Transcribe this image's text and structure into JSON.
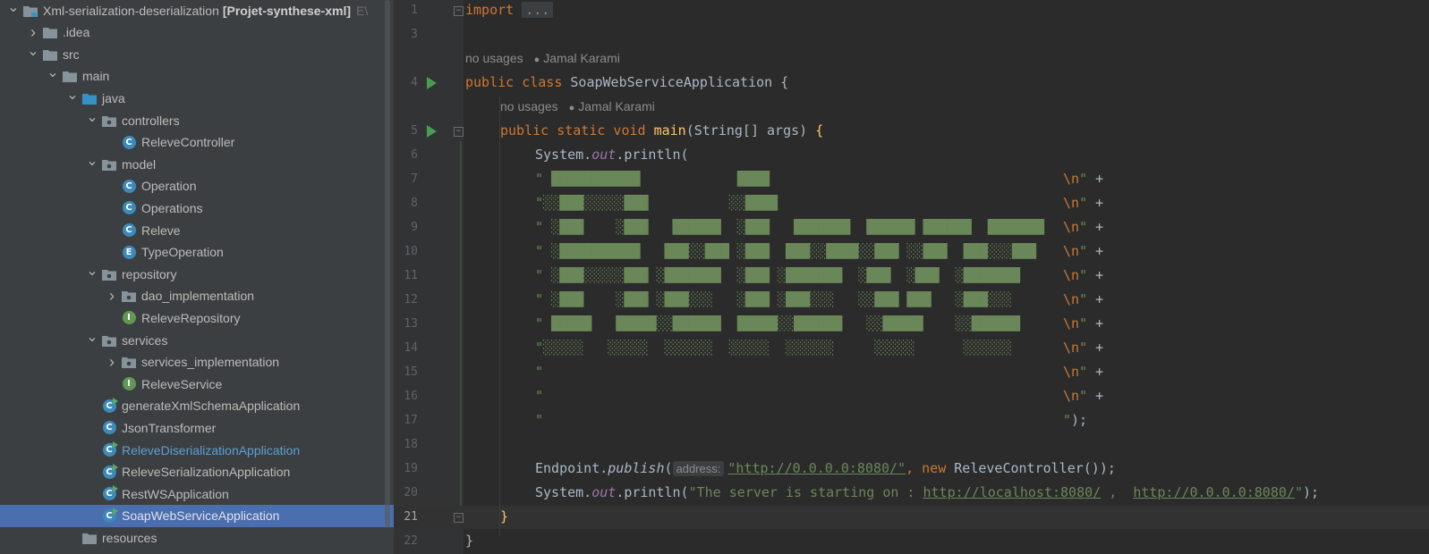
{
  "project_tree": {
    "rows": [
      {
        "label": "Xml-serialization-deserialization",
        "bold_suffix": "[Projet-synthese-xml]",
        "truncated": "E\\",
        "indent": 0,
        "chevron": "down",
        "icon": "module-folder-icon"
      },
      {
        "label": ".idea",
        "indent": 1,
        "chevron": "right",
        "icon": "folder-icon"
      },
      {
        "label": "src",
        "indent": 1,
        "chevron": "down",
        "icon": "folder-icon"
      },
      {
        "label": "main",
        "indent": 2,
        "chevron": "down",
        "icon": "folder-icon"
      },
      {
        "label": "java",
        "indent": 3,
        "chevron": "down",
        "icon": "source-folder-icon"
      },
      {
        "label": "controllers",
        "indent": 4,
        "chevron": "down",
        "icon": "package-icon"
      },
      {
        "label": "ReleveController",
        "indent": 5,
        "chevron": "",
        "icon": "class-icon"
      },
      {
        "label": "model",
        "indent": 4,
        "chevron": "down",
        "icon": "package-icon"
      },
      {
        "label": "Operation",
        "indent": 5,
        "chevron": "",
        "icon": "class-icon"
      },
      {
        "label": "Operations",
        "indent": 5,
        "chevron": "",
        "icon": "class-icon"
      },
      {
        "label": "Releve",
        "indent": 5,
        "chevron": "",
        "icon": "class-icon"
      },
      {
        "label": "TypeOperation",
        "indent": 5,
        "chevron": "",
        "icon": "enum-icon"
      },
      {
        "label": "repository",
        "indent": 4,
        "chevron": "down",
        "icon": "package-icon"
      },
      {
        "label": "dao_implementation",
        "indent": 5,
        "chevron": "right",
        "icon": "package-icon"
      },
      {
        "label": "ReleveRepository",
        "indent": 5,
        "chevron": "",
        "icon": "interface-icon"
      },
      {
        "label": "services",
        "indent": 4,
        "chevron": "down",
        "icon": "package-icon"
      },
      {
        "label": "services_implementation",
        "indent": 5,
        "chevron": "right",
        "icon": "package-icon"
      },
      {
        "label": "ReleveService",
        "indent": 5,
        "chevron": "",
        "icon": "interface-icon"
      },
      {
        "label": "generateXmlSchemaApplication",
        "indent": 4,
        "chevron": "",
        "icon": "runnable-class-icon"
      },
      {
        "label": "JsonTransformer",
        "indent": 4,
        "chevron": "",
        "icon": "class-icon"
      },
      {
        "label": "ReleveDiserializationApplication",
        "indent": 4,
        "chevron": "",
        "icon": "runnable-class-icon",
        "muted_blue": true
      },
      {
        "label": "ReleveSerializationApplication",
        "indent": 4,
        "chevron": "",
        "icon": "runnable-class-icon"
      },
      {
        "label": "RestWSApplication",
        "indent": 4,
        "chevron": "",
        "icon": "runnable-class-icon"
      },
      {
        "label": "SoapWebServiceApplication",
        "indent": 4,
        "chevron": "",
        "icon": "runnable-class-icon",
        "selected": true
      },
      {
        "label": "resources",
        "indent": 3,
        "chevron": "",
        "icon": "resources-folder-icon"
      }
    ]
  },
  "editor": {
    "file_class": "SoapWebServiceApplication",
    "current_line": "21",
    "line_numbers": [
      "1",
      "3",
      "4",
      "5",
      "6",
      "7",
      "8",
      "9",
      "10",
      "11",
      "12",
      "13",
      "14",
      "15",
      "16",
      "17",
      "18",
      "19",
      "20",
      "21",
      "22"
    ],
    "hints": {
      "usages": "no usages",
      "author": "Jamal Karami"
    },
    "code": {
      "l1_kw": "import",
      "l1_fold": "...",
      "l4_kw": "public class",
      "l4_name": "SoapWebServiceApplication",
      "l4_brace": " {",
      "l5_kw": "public static void",
      "l5_fn": "main",
      "l5_rest": "(String[] args) ",
      "l5_brace": "{",
      "l6_a": "System.",
      "l6_out": "out",
      "l6_b": ".println(",
      "banner_lines": [
        "\" ███████████            ████                                                 ",
        "\"░░███░░░░░███          ░░████                                                ",
        "\" ░███    ░███   ██████  ░███   ███████  ██████ ██████  ███████               ",
        "\" ░██████████   ███░░███ ░███  ███░░████░░███ ░░███  ███░░░███               ",
        "\" ░███░░░░░███ ░███████  ░███ ░███████  ░███  ░███  ░███████                ",
        "\" ░███    ░███ ░███░░░   ░███ ░███░░░   ░░███ ███   ░███░░░                 ",
        "\" █████   █████░░██████  █████░░██████   ░░█████    ░░██████                ",
        "\"░░░░░   ░░░░░  ░░░░░░  ░░░░░  ░░░░░░     ░░░░░      ░░░░░░                 ",
        "\"                                                                              ",
        "\"                                                                              ",
        "\"                                                                              "
      ],
      "banner_ends": [
        "\\n\" +",
        "\\n\" +",
        "\\n\" +",
        "\\n\" +",
        "\\n\" +",
        "\\n\" +",
        "\\n\" +",
        "\\n\" +",
        "\\n\" +",
        "\\n\" +",
        "\");"
      ],
      "l19_a": "Endpoint.",
      "l19_fn": "publish",
      "l19_paren": "(",
      "l19_param": "address:",
      "l19_url": "\"http://0.0.0.0:8080/\"",
      "l19_new": ", new",
      "l19_rest": " ReleveController());",
      "l20_a": "System.",
      "l20_out": "out",
      "l20_b": ".println(",
      "l20_str1": "\"The server is starting on : ",
      "l20_url1": "http://localhost:8080/",
      "l20_mid": " ,  ",
      "l20_url2": "http://0.0.0.0:8080/",
      "l20_end_str": "\"",
      "l20_end": ");",
      "l21_brace": "}",
      "l22_brace": "}"
    }
  }
}
